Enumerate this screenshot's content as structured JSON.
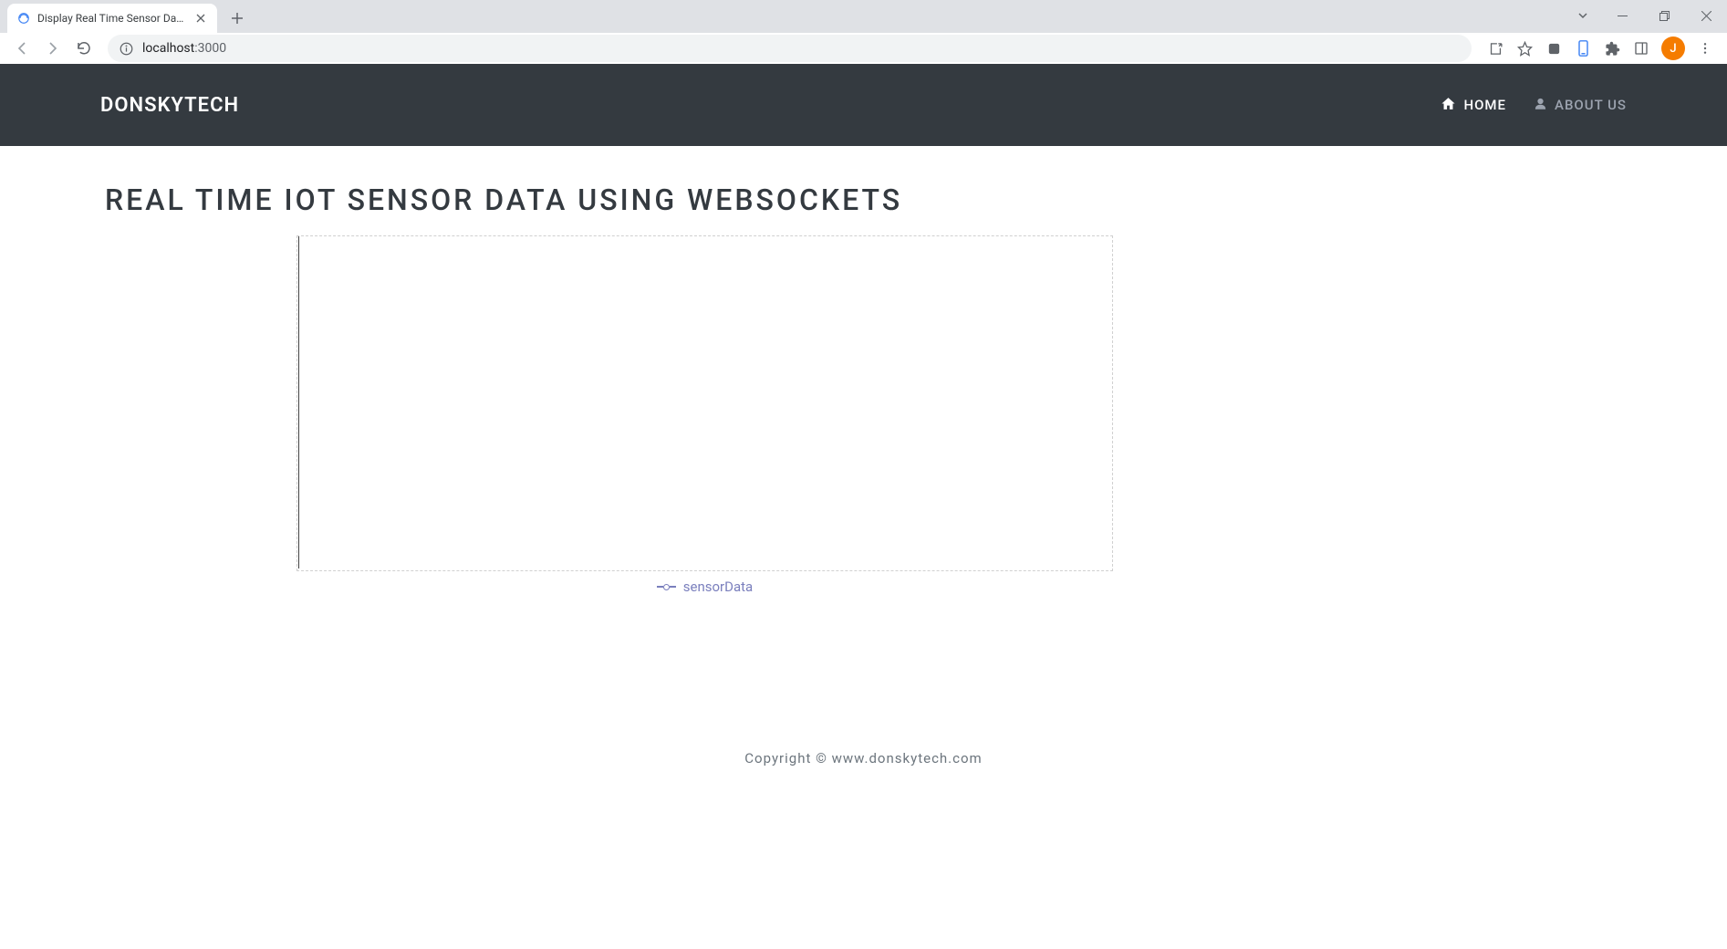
{
  "browser": {
    "tab_title": "Display Real Time Sensor Data th",
    "url_host": "localhost",
    "url_port": ":3000",
    "profile_initial": "J"
  },
  "header": {
    "brand": "DONSKYTECH",
    "nav": [
      {
        "label": "HOME",
        "active": true
      },
      {
        "label": "ABOUT US",
        "active": false
      }
    ]
  },
  "page": {
    "title": "REAL TIME IOT SENSOR DATA USING WEBSOCKETS",
    "legend_label": "sensorData",
    "footer": "Copyright © www.donskytech.com"
  },
  "chart_data": {
    "type": "line",
    "title": "",
    "xlabel": "",
    "ylabel": "",
    "series": [
      {
        "name": "sensorData",
        "values": []
      }
    ],
    "x": []
  }
}
